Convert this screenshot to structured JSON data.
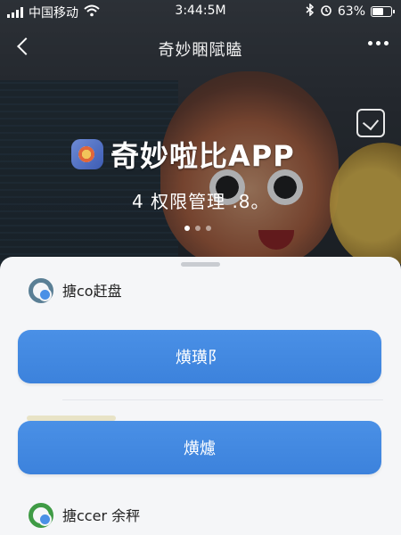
{
  "status_bar": {
    "carrier": "中国移动",
    "time": "3:44:5M",
    "battery": "63%"
  },
  "nav": {
    "title": "奇妙睏陚瞌"
  },
  "hero": {
    "app_name": "奇妙啦比APP",
    "subtitle": "4 权限管理 .8。"
  },
  "sheet": {
    "option_top": {
      "label": "搪co赶盘",
      "icon": "ring-icon",
      "color": "#5a7f95",
      "badge_color": "#4a90e6"
    },
    "primary_button": "熿璜阝",
    "secondary_button": "熿爈",
    "option_bottom": {
      "label": "搪ccer 余秤",
      "icon": "ring-icon",
      "color": "#3f9b45",
      "badge_color": "#4a90e6"
    }
  },
  "colors": {
    "accent_button": "#3c82dc",
    "sheet_bg": "#f5f6f8"
  }
}
